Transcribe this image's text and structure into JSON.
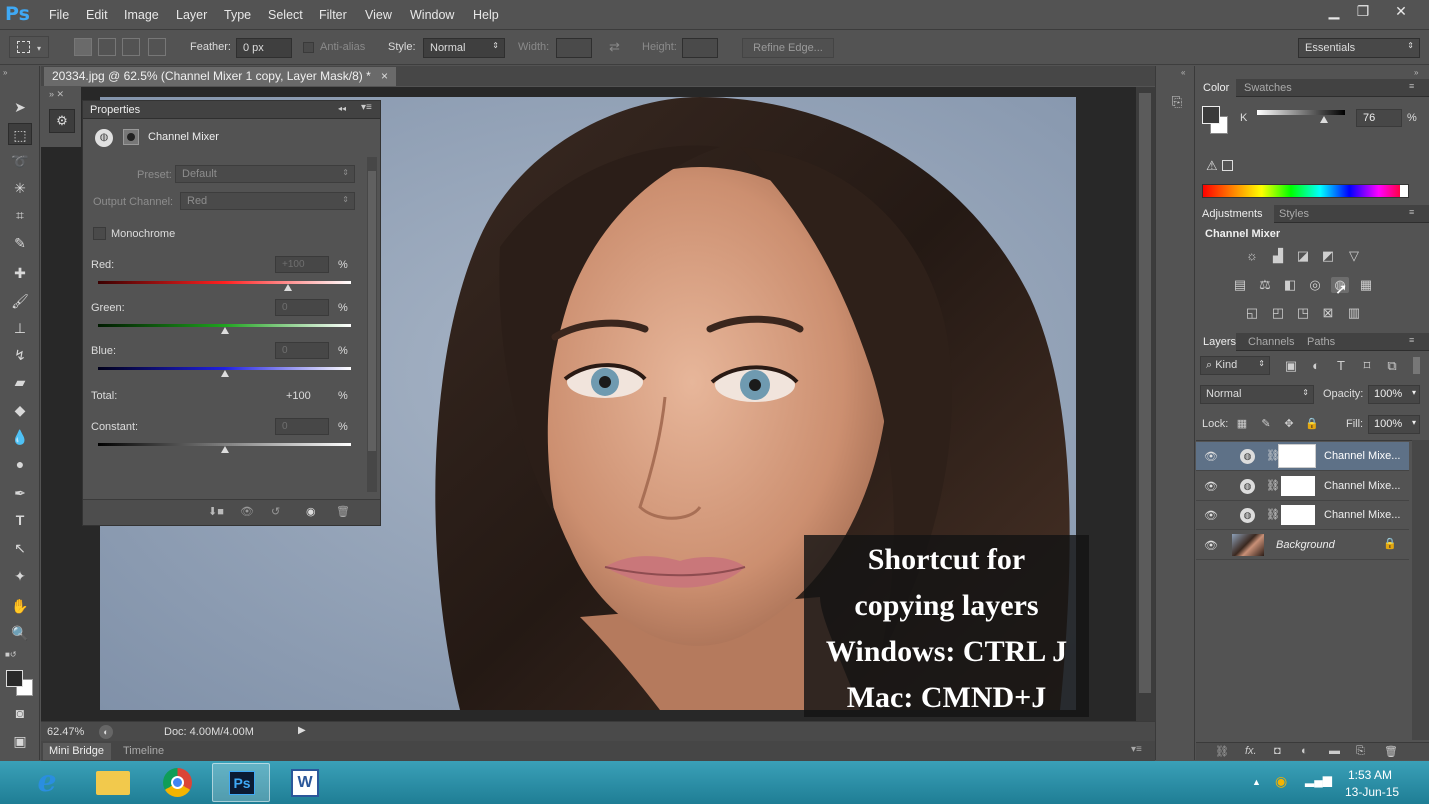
{
  "app": {
    "logo": "Ps"
  },
  "menu": [
    "File",
    "Edit",
    "Image",
    "Layer",
    "Type",
    "Select",
    "Filter",
    "View",
    "Window",
    "Help"
  ],
  "window_controls": {
    "minimize": "▁",
    "restore": "❐",
    "close": "✕"
  },
  "options": {
    "feather_label": "Feather:",
    "feather_value": "0 px",
    "antialias_label": "Anti-alias",
    "style_label": "Style:",
    "style_value": "Normal",
    "width_label": "Width:",
    "height_label": "Height:",
    "refine_label": "Refine Edge...",
    "workspace": "Essentials"
  },
  "document": {
    "tab_title": "20334.jpg @ 62.5% (Channel Mixer 1 copy, Layer Mask/8) *",
    "close": "×"
  },
  "properties": {
    "title": "Properties",
    "panel_name": "Channel Mixer",
    "preset_label": "Preset:",
    "preset_value": "Default",
    "output_label": "Output Channel:",
    "output_value": "Red",
    "monochrome_label": "Monochrome",
    "red_label": "Red:",
    "red_value": "+100",
    "red_pct": "%",
    "red_level": 0.75,
    "green_label": "Green:",
    "green_value": "0",
    "green_pct": "%",
    "green_level": 0.5,
    "blue_label": "Blue:",
    "blue_value": "0",
    "blue_pct": "%",
    "blue_level": 0.5,
    "total_label": "Total:",
    "total_value": "+100",
    "total_pct": "%",
    "constant_label": "Constant:",
    "constant_value": "0",
    "constant_pct": "%",
    "constant_level": 0.5
  },
  "status": {
    "zoom": "62.47%",
    "doc": "Doc: 4.00M/4.00M"
  },
  "bottom_tabs": [
    "Mini Bridge",
    "Timeline"
  ],
  "color_panel": {
    "tabs": [
      "Color",
      "Swatches"
    ],
    "channel": "K",
    "value": "76",
    "pct": "%",
    "k_level": 0.76
  },
  "adjustments": {
    "tabs": [
      "Adjustments",
      "Styles"
    ],
    "current": "Channel Mixer"
  },
  "layers": {
    "tabs": [
      "Layers",
      "Channels",
      "Paths"
    ],
    "kind": "Kind",
    "blend": "Normal",
    "opacity_label": "Opacity:",
    "opacity_value": "100%",
    "lock_label": "Lock:",
    "fill_label": "Fill:",
    "fill_value": "100%",
    "rows": [
      {
        "name": "Channel Mixe...",
        "selected": true
      },
      {
        "name": "Channel Mixe...",
        "selected": false
      },
      {
        "name": "Channel Mixe...",
        "selected": false
      },
      {
        "name": "Background",
        "selected": false
      }
    ]
  },
  "overlay": {
    "lines": [
      "Shortcut for",
      "copying layers",
      "Windows: CTRL J",
      "Mac: CMND+J"
    ]
  },
  "taskbar": {
    "time": "1:53 AM",
    "date": "13-Jun-15"
  }
}
